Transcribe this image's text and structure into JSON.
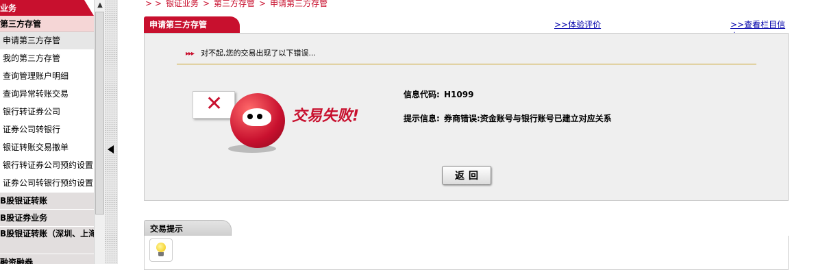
{
  "sidebar": {
    "top_label": "业务",
    "group_label": "第三方存管",
    "items": [
      {
        "label": "申请第三方存管"
      },
      {
        "label": "我的第三方存管"
      },
      {
        "label": "查询管理账户明细"
      },
      {
        "label": "查询异常转账交易"
      },
      {
        "label": "银行转证券公司"
      },
      {
        "label": "证券公司转银行"
      },
      {
        "label": "银证转账交易撤单"
      },
      {
        "label": "银行转证券公司预约设置"
      },
      {
        "label": "证券公司转银行预约设置"
      }
    ],
    "sections": [
      {
        "label": "B股银证转账"
      },
      {
        "label": "B股证券业务"
      },
      {
        "label": "B股银证转账（深圳、上海）"
      },
      {
        "label": "融资融券"
      }
    ]
  },
  "breadcrumb": {
    "prefix": "> >",
    "items": [
      "银证业务",
      "第三方存管",
      "申请第三方存管"
    ],
    "separator": ">"
  },
  "panel": {
    "title": "申请第三方存管",
    "link_experience": ">>体验评价",
    "link_column_info": ">>查看栏目信息"
  },
  "error": {
    "arrow_glyph": "▸▸▸",
    "message": "对不起,您的交易出现了以下错误...",
    "fail_text": "交易失败!",
    "code_label": "信息代码:",
    "code_value": "H1099",
    "hint_label": "提示信息:",
    "hint_value": "券商错误:资金账号与银行账号已建立对应关系",
    "back_button": "返回"
  },
  "tips": {
    "title": "交易提示"
  },
  "colors": {
    "brand_red": "#c8102e",
    "link_blue": "#0000aa",
    "rule_gold": "#c9a227"
  }
}
